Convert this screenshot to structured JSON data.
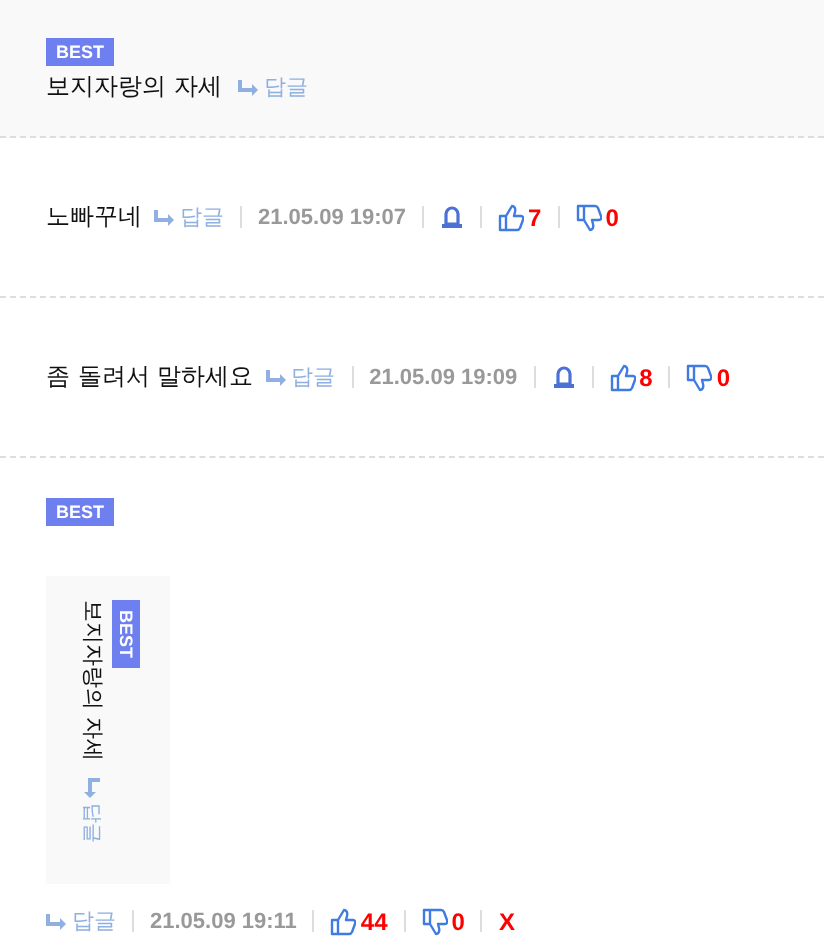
{
  "best_comment": {
    "badge": "BEST",
    "text": "보지자랑의 자세",
    "reply": "답글"
  },
  "comments": [
    {
      "text": "노빠꾸네",
      "reply": "답글",
      "date": "21.05.09 19:07",
      "report": true,
      "likes": "7",
      "dislikes": "0"
    },
    {
      "text": "좀 돌려서 말하세요",
      "reply": "답글",
      "date": "21.05.09 19:09",
      "report": true,
      "likes": "8",
      "dislikes": "0"
    },
    {
      "badge": "BEST",
      "quote": {
        "badge": "BEST",
        "text": "보지자랑의 자세",
        "reply": "답글"
      },
      "reply": "답글",
      "date": "21.05.09 19:11",
      "report": false,
      "likes": "44",
      "dislikes": "0",
      "delete": "X"
    }
  ]
}
